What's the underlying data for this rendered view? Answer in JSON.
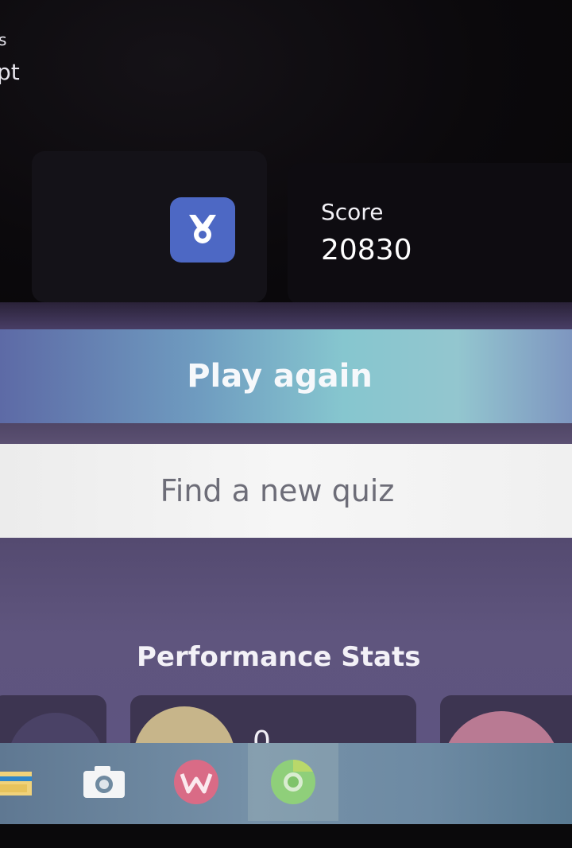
{
  "overlay_fragments": {
    "line1": "s",
    "line2": "pt"
  },
  "result": {
    "medal_icon": "medal-icon",
    "score_label": "Score",
    "score_value": "20830"
  },
  "actions": {
    "play_again": "Play again",
    "find_quiz": "Find a new quiz"
  },
  "performance": {
    "title": "Performance Stats",
    "card2_value_partial": "0"
  },
  "taskbar": {
    "items": [
      {
        "icon": "file-explorer-icon"
      },
      {
        "icon": "camera-icon"
      },
      {
        "icon": "wps-office-icon"
      },
      {
        "icon": "chrome-icon",
        "active": true
      }
    ]
  },
  "colors": {
    "accent_blue": "#4d68c4",
    "play_again_gradient": "#86c6cf",
    "panel_purple": "#5e5480"
  }
}
